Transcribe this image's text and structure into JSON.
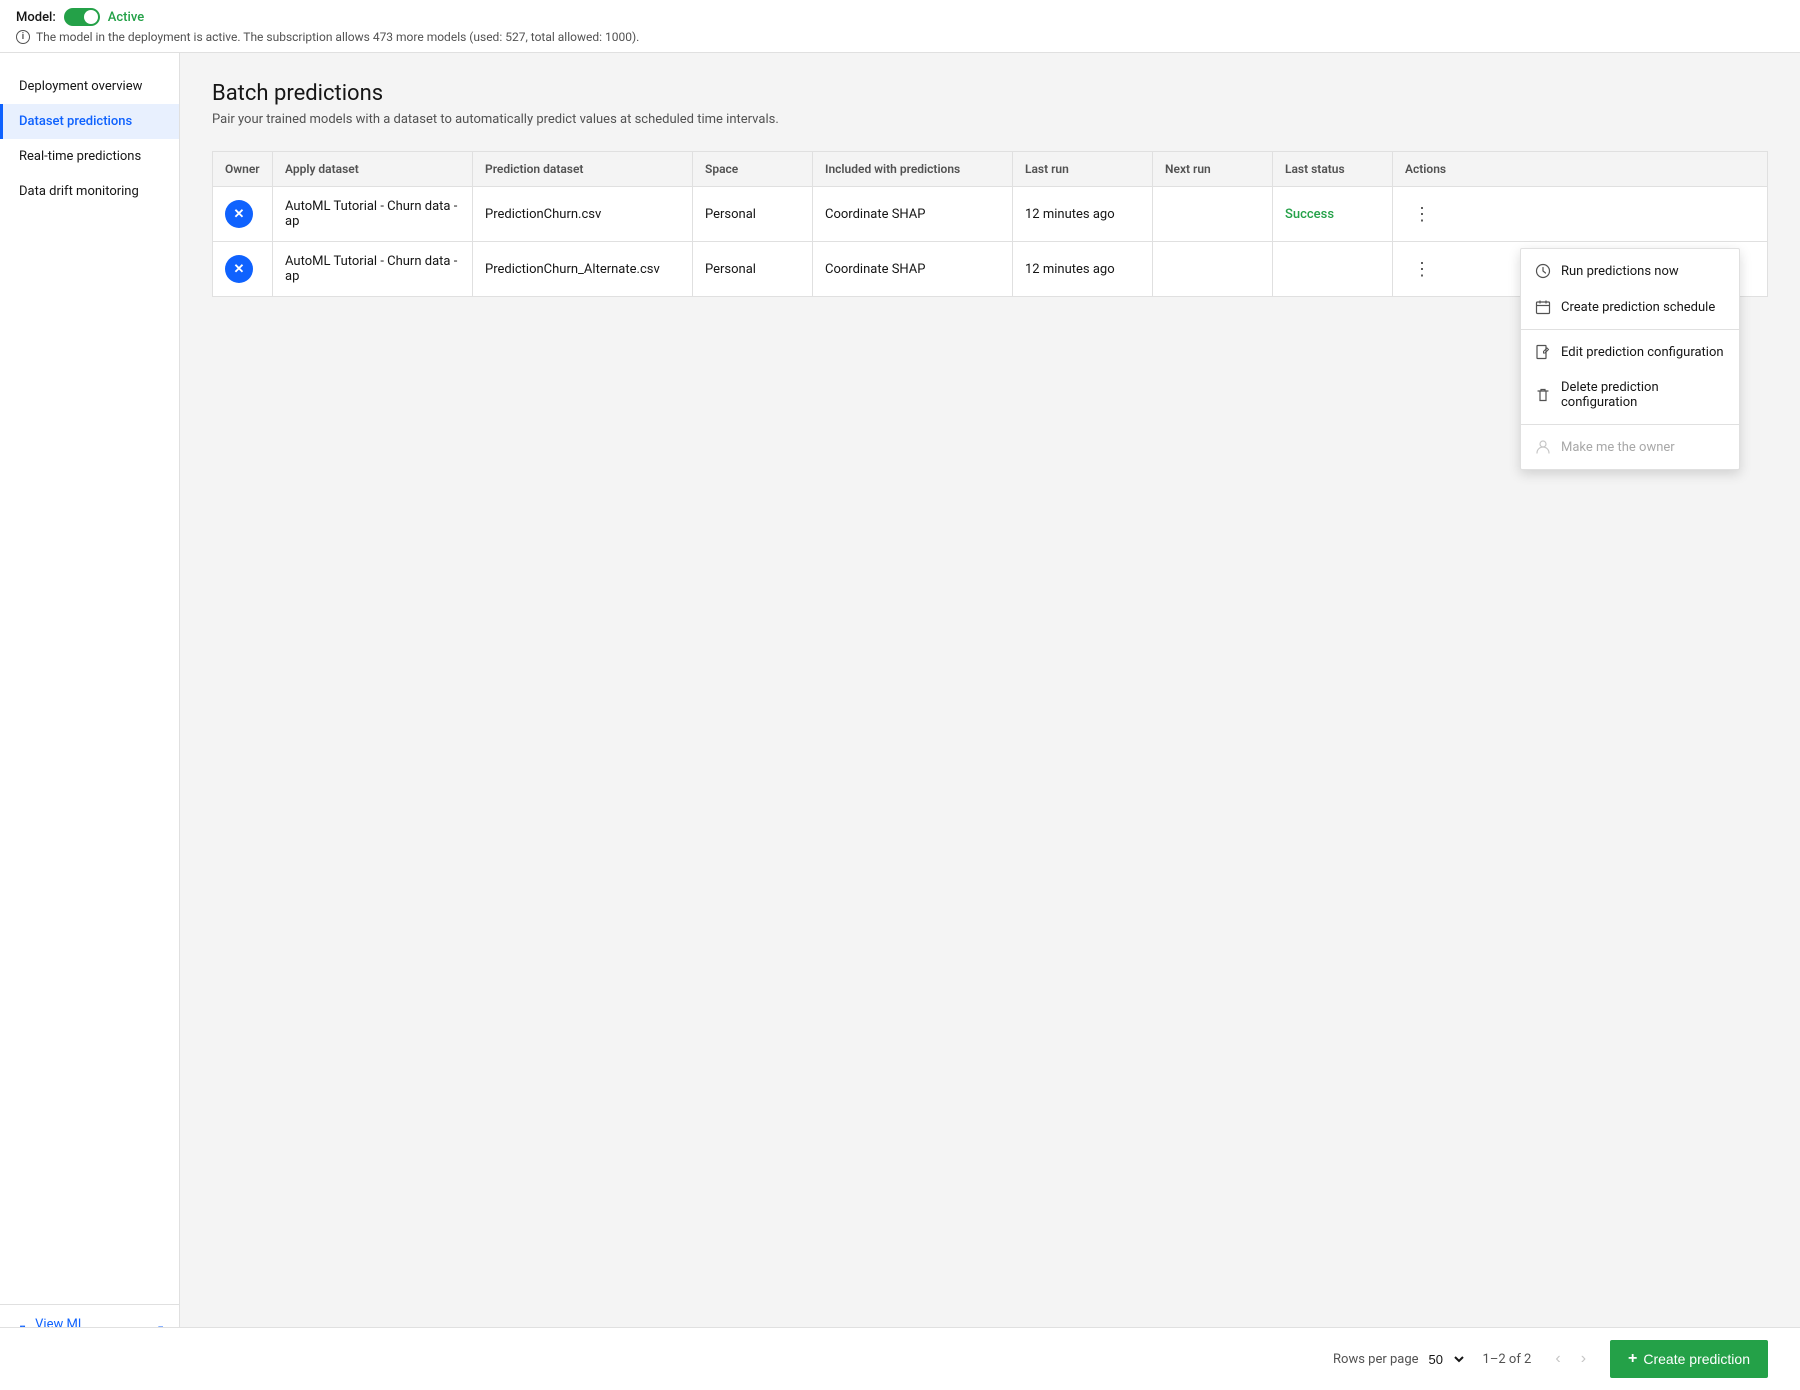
{
  "topbar": {
    "model_label": "Model:",
    "model_status": "Active",
    "info_text": "The model in the deployment is active. The subscription allows 473 more models (used: 527, total allowed: 1000)."
  },
  "sidebar": {
    "items": [
      {
        "id": "deployment-overview",
        "label": "Deployment overview",
        "active": false
      },
      {
        "id": "dataset-predictions",
        "label": "Dataset predictions",
        "active": true
      },
      {
        "id": "realtime-predictions",
        "label": "Real-time predictions",
        "active": false
      },
      {
        "id": "data-drift-monitoring",
        "label": "Data drift monitoring",
        "active": false
      }
    ],
    "view_experiment_label": "View ML experiment"
  },
  "main": {
    "title": "Batch predictions",
    "subtitle": "Pair your trained models with a dataset to automatically predict values at scheduled time intervals.",
    "table": {
      "columns": [
        "Owner",
        "Apply dataset",
        "Prediction dataset",
        "Space",
        "Included with predictions",
        "Last run",
        "Next run",
        "Last status",
        "Actions"
      ],
      "rows": [
        {
          "owner_type": "icon",
          "apply_dataset": "AutoML Tutorial - Churn data - ap",
          "prediction_dataset": "PredictionChurn.csv",
          "space": "Personal",
          "included_with_predictions": "Coordinate SHAP",
          "last_run": "12 minutes ago",
          "next_run": "",
          "last_status": "Success",
          "show_menu": true
        },
        {
          "owner_type": "icon",
          "apply_dataset": "AutoML Tutorial - Churn data - ap",
          "prediction_dataset": "PredictionChurn_Alternate.csv",
          "space": "Personal",
          "included_with_predictions": "Coordinate SHAP",
          "last_run": "12 minutes ago",
          "next_run": "",
          "last_status": "",
          "show_menu": false
        }
      ]
    }
  },
  "dropdown": {
    "items": [
      {
        "id": "run-predictions-now",
        "label": "Run predictions now",
        "icon": "clock",
        "disabled": false,
        "section": 1
      },
      {
        "id": "create-prediction-schedule",
        "label": "Create prediction schedule",
        "icon": "calendar",
        "disabled": false,
        "section": 1
      },
      {
        "id": "edit-prediction-configuration",
        "label": "Edit prediction configuration",
        "icon": "edit-doc",
        "disabled": false,
        "section": 2
      },
      {
        "id": "delete-prediction-configuration",
        "label": "Delete prediction configuration",
        "icon": "trash",
        "disabled": false,
        "section": 2
      },
      {
        "id": "make-me-owner",
        "label": "Make me the owner",
        "icon": "person",
        "disabled": true,
        "section": 3
      }
    ]
  },
  "bottombar": {
    "rows_per_page_label": "Rows per page",
    "rows_per_page_value": "50",
    "pagination_text": "1–2 of 2",
    "create_prediction_label": "Create prediction"
  }
}
